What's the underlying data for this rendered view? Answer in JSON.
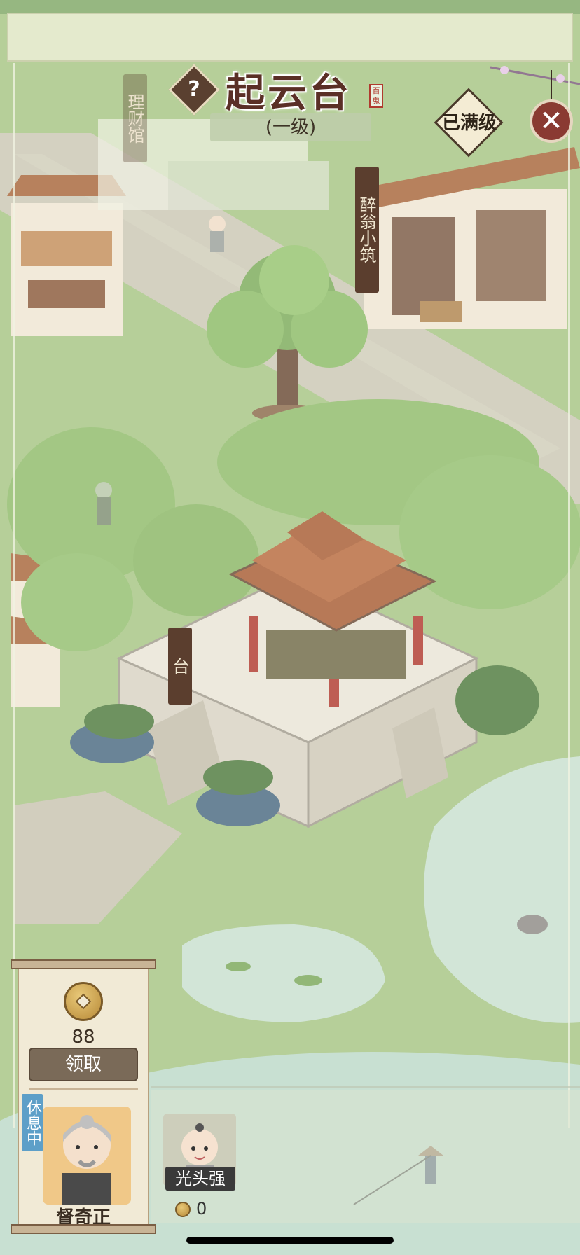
{
  "header": {
    "building_name": "起云台",
    "seal_text": "百鬼",
    "level": "(一级)",
    "max_level_badge": "已满级",
    "help_symbol": "?",
    "close_symbol": "✕"
  },
  "map_signs": {
    "licai": "理财馆",
    "zuiweng": "醉翁小筑",
    "tai": "台"
  },
  "reward_panel": {
    "amount": "88",
    "collect_label": "领取",
    "status": "休息中",
    "manager_name": "督奇正"
  },
  "worker": {
    "name": "光头强",
    "coin_value": "0"
  },
  "colors": {
    "grass": "#9fc07a",
    "road": "#c9c4b2",
    "title_text": "#5a2f26",
    "status_tag": "#5d9fc8"
  }
}
